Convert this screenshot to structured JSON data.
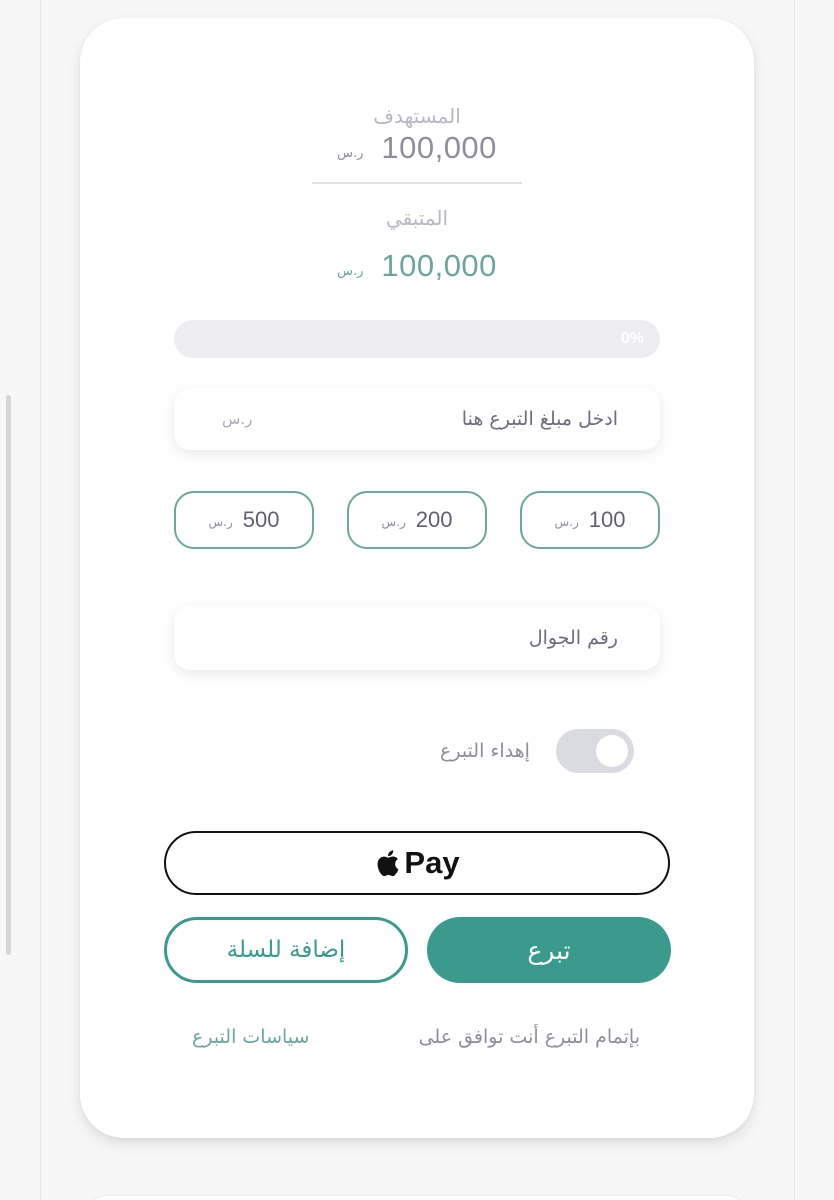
{
  "target": {
    "label": "المستهدف",
    "amount": "100,000",
    "currency": "ر.س"
  },
  "remaining": {
    "label": "المتبقي",
    "amount": "100,000",
    "currency": "ر.س"
  },
  "progress": {
    "percent": 0,
    "text": "0%"
  },
  "donation_amount": {
    "placeholder": "ادخل مبلغ التبرع هنا",
    "value": "",
    "currency": "ر.س"
  },
  "presets": [
    {
      "value": "500",
      "currency": "ر.س"
    },
    {
      "value": "200",
      "currency": "ر.س"
    },
    {
      "value": "100",
      "currency": "ر.س"
    }
  ],
  "phone": {
    "placeholder": "رقم الجوال",
    "value": ""
  },
  "gift": {
    "label": "إهداء التبرع",
    "enabled": false
  },
  "apple_pay": {
    "label": "Pay",
    "icon": "apple-icon"
  },
  "buttons": {
    "add_to_cart": "إضافة للسلة",
    "donate": "تبرع"
  },
  "terms": {
    "text": "بإتمام التبرع أنت توافق على",
    "link": "سياسات التبرع"
  },
  "colors": {
    "accent": "#3a9b8d",
    "accent_light": "#6ba59b",
    "muted": "#8c8e98",
    "track": "#ededf1"
  }
}
